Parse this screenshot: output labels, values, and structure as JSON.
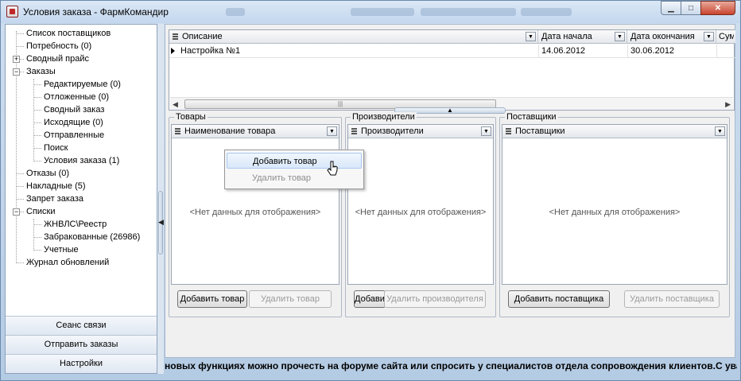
{
  "window": {
    "title": "Условия заказа - ФармКомандир",
    "controls": {
      "minimize": "▁",
      "maximize": "□",
      "close": "✕"
    }
  },
  "sidebar": {
    "tree": [
      {
        "label": "Список поставщиков",
        "level": 0
      },
      {
        "label": "Потребность (0)",
        "level": 0
      },
      {
        "label": "Сводный прайс",
        "level": 0,
        "expander": "+"
      },
      {
        "label": "Заказы",
        "level": 0,
        "expander": "−"
      },
      {
        "label": "Редактируемые (0)",
        "level": 1
      },
      {
        "label": "Отложенные (0)",
        "level": 1
      },
      {
        "label": "Сводный заказ",
        "level": 1
      },
      {
        "label": "Исходящие (0)",
        "level": 1
      },
      {
        "label": "Отправленные",
        "level": 1
      },
      {
        "label": "Поиск",
        "level": 1
      },
      {
        "label": "Условия заказа (1)",
        "level": 1
      },
      {
        "label": "Отказы (0)",
        "level": 0
      },
      {
        "label": "Накладные (5)",
        "level": 0
      },
      {
        "label": "Запрет заказа",
        "level": 0
      },
      {
        "label": "Списки",
        "level": 0,
        "expander": "−"
      },
      {
        "label": "ЖНВЛС\\Реестр",
        "level": 1
      },
      {
        "label": "Забракованные (26986)",
        "level": 1
      },
      {
        "label": "Учетные",
        "level": 1
      },
      {
        "label": "Журнал обновлений",
        "level": 0
      }
    ],
    "buttons": [
      "Сеанс связи",
      "Отправить заказы",
      "Настройки"
    ]
  },
  "orders_grid": {
    "columns": [
      "Описание",
      "Дата начала",
      "Дата окончания",
      "Сум"
    ],
    "rows": [
      {
        "description": "Настройка №1",
        "start": "14.06.2012",
        "end": "30.06.2012"
      }
    ]
  },
  "panels": {
    "goods": {
      "title": "Товары",
      "column": "Наименование товара",
      "empty": "<Нет данных для отображения>",
      "add_btn": "Добавить товар",
      "remove_btn": "Удалить товар"
    },
    "manufacturers": {
      "title": "Производители",
      "column": "Производители",
      "empty": "<Нет данных для отображения>",
      "add_btn": "Добавить",
      "remove_btn": "Удалить производителя"
    },
    "suppliers": {
      "title": "Поставщики",
      "column": "Поставщики",
      "empty": "<Нет данных для отображения>",
      "add_btn": "Добавить поставщика",
      "remove_btn": "Удалить поставщика"
    }
  },
  "context_menu": {
    "items": [
      {
        "label": "Добавить товар",
        "enabled": true
      },
      {
        "label": "Удалить товар",
        "enabled": false
      }
    ]
  },
  "ticker": "новых функциях можно прочесть на форуме сайта или спросить у специалистов отдела сопровождения клиентов.С уважением"
}
